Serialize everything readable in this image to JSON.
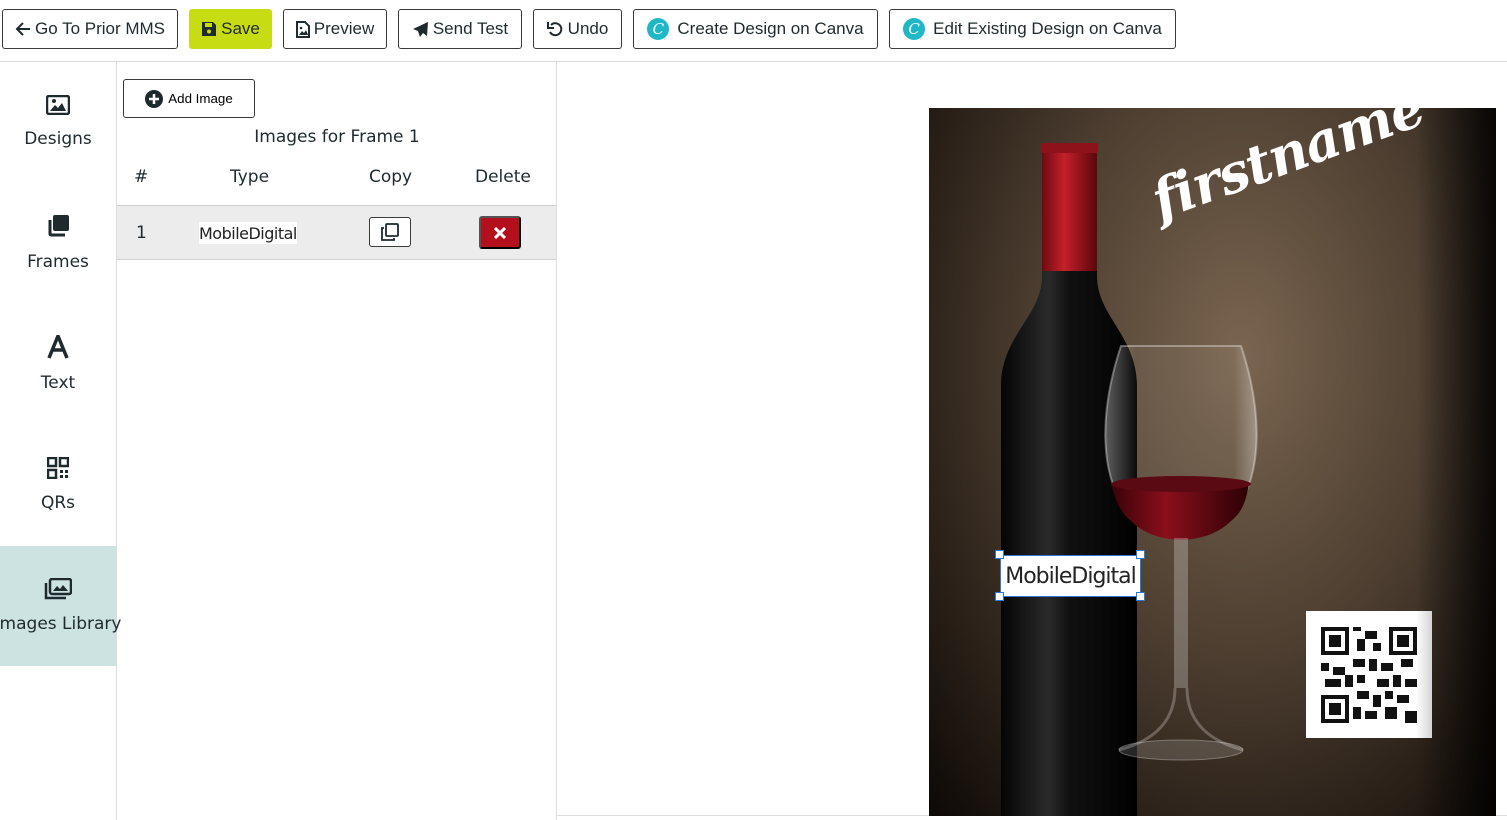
{
  "toolbar": {
    "prior_label": "Go To Prior MMS",
    "save_label": "Save",
    "preview_label": "Preview",
    "send_test_label": "Send Test",
    "undo_label": "Undo",
    "create_canva_label": "Create Design on Canva",
    "edit_canva_label": "Edit Existing Design on Canva"
  },
  "sidebar": {
    "items": [
      {
        "label": "Designs",
        "icon": "image-icon"
      },
      {
        "label": "Frames",
        "icon": "layers-icon"
      },
      {
        "label": "Text",
        "icon": "text-icon"
      },
      {
        "label": "QRs",
        "icon": "qr-icon"
      },
      {
        "label": "Images Library",
        "icon": "images-library-icon",
        "active": true
      }
    ]
  },
  "panel": {
    "add_label": "Add Image",
    "title": "Images for Frame 1",
    "columns": [
      "#",
      "Type",
      "Copy",
      "Delete"
    ],
    "rows": [
      {
        "num": "1",
        "type": "MobileDigital"
      }
    ]
  },
  "design": {
    "firstname_text": "firstname",
    "logo_text": "MobileDigital"
  },
  "colors": {
    "save_accent": "#c8dc14",
    "active_nav": "#cde3e1",
    "delete": "#b3101c",
    "canva": "#1fb8c9"
  }
}
